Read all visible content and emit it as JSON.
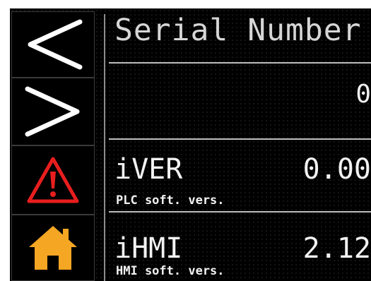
{
  "sidebar": {
    "prev_icon": "chevron-left-icon",
    "next_icon": "chevron-right-icon",
    "alarm_icon": "warning-triangle-icon",
    "home_icon": "home-icon",
    "alarm_color": "#e81e1e",
    "home_color": "#f5a623"
  },
  "header": {
    "title": "Serial Number"
  },
  "serial": {
    "value": "0"
  },
  "params": [
    {
      "code": "iVER",
      "value": "0.00",
      "description": "PLC soft. vers."
    },
    {
      "code": "iHMI",
      "value": "2.12",
      "description": "HMI soft. vers."
    }
  ]
}
